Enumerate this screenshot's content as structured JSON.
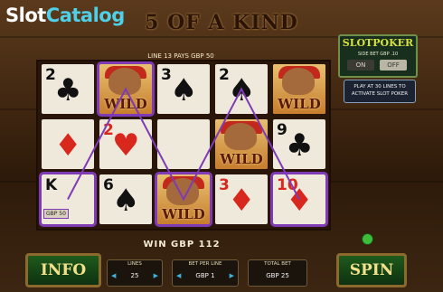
{
  "watermark": {
    "part1": "Slot",
    "part2": "Catalog"
  },
  "headline": "5 OF A KIND",
  "pays_line": "LINE 13 PAYS GBP  50",
  "side_bet": {
    "title": "SLOTPOKER",
    "subtitle": "SIDE BET GBP .10",
    "on_label": "ON",
    "off_label": "OFF"
  },
  "promo_text": "PLAY AT 30 LINES TO ACTIVATE SLOT POKER",
  "win_text": "WIN GBP  112",
  "badge_text": "GBP  50",
  "controls": {
    "info": "INFO",
    "spin": "SPIN",
    "lines_label": "LINES",
    "lines_value": "25",
    "bet_label": "BET PER LINE",
    "bet_value": "GBP  1",
    "total_label": "TOTAL BET",
    "total_value": "GBP  25"
  },
  "reels": [
    [
      {
        "type": "card",
        "rank": "2",
        "suit": "♣",
        "color": "black"
      },
      {
        "type": "card",
        "rank": "",
        "suit": "♦",
        "color": "red"
      },
      {
        "type": "card",
        "rank": "K",
        "suit": "",
        "color": "black",
        "highlight": true,
        "badge": true
      }
    ],
    [
      {
        "type": "wild",
        "label": "WILD",
        "highlight": true
      },
      {
        "type": "card",
        "rank": "2",
        "suit": "♥",
        "color": "red"
      },
      {
        "type": "card",
        "rank": "6",
        "suit": "♠",
        "color": "black"
      }
    ],
    [
      {
        "type": "card",
        "rank": "3",
        "suit": "♠",
        "color": "black"
      },
      {
        "type": "card",
        "rank": "",
        "suit": "",
        "color": "black"
      },
      {
        "type": "wild",
        "label": "WILD",
        "highlight": true
      }
    ],
    [
      {
        "type": "card",
        "rank": "2",
        "suit": "♠",
        "color": "black"
      },
      {
        "type": "wild",
        "label": "WILD"
      },
      {
        "type": "card",
        "rank": "3",
        "suit": "♦",
        "color": "red"
      }
    ],
    [
      {
        "type": "wild",
        "label": "WILD"
      },
      {
        "type": "card",
        "rank": "9",
        "suit": "♣",
        "color": "black"
      },
      {
        "type": "card",
        "rank": "10",
        "suit": "♦",
        "color": "red",
        "highlight": true
      }
    ]
  ],
  "colors": {
    "payline": "#7e3bb5",
    "button_green": "#1e5a1c",
    "button_text": "#f3e08a"
  }
}
